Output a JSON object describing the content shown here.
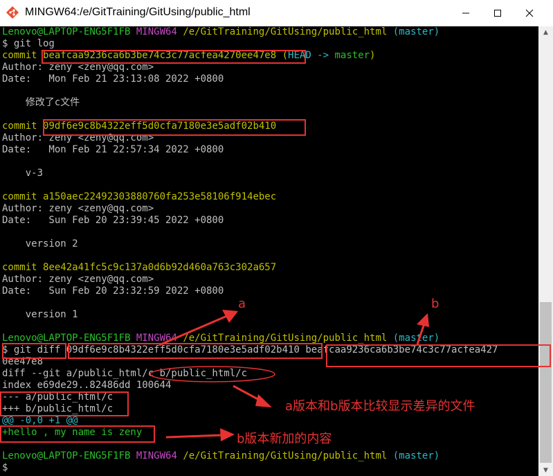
{
  "window": {
    "title": "MINGW64:/e/GitTraining/GitUsing/public_html",
    "icon": "git-bash-icon",
    "minimize_glyph": "—",
    "maximize_glyph": "☐",
    "close_glyph": "✕"
  },
  "colors": {
    "prompt_green": "#2bc02b",
    "prompt_magenta": "#c44ac4",
    "yellow": "#c0c000",
    "cyan": "#2fb8c6",
    "annotation_red": "#e83232"
  },
  "prompt": {
    "user_host": "Lenovo@LAPTOP-ENG5F1FB",
    "shell": "MINGW64",
    "path": "/e/GitTraining/GitUsing/public_html",
    "branch": "(master)"
  },
  "terminal": {
    "cmd_log": "$ git log",
    "commits": [
      {
        "commit_label": "commit ",
        "hash": "beafcaa9236ca6b3be74c3c77acfea4270ee47e8",
        "ref_open": " (",
        "ref_head": "HEAD -> ",
        "ref_master": "master",
        "ref_close": ")",
        "author": "Author: zeny <zeny@qq.com>",
        "date": "Date:   Mon Feb 21 23:13:08 2022 +0800",
        "message": "    修改了c文件"
      },
      {
        "commit_label": "commit ",
        "hash": "09df6e9c8b4322eff5d0cfa7180e3e5adf02b410",
        "author": "Author: zeny <zeny@qq.com>",
        "date": "Date:   Mon Feb 21 22:57:34 2022 +0800",
        "message": "    v-3"
      },
      {
        "commit_label": "commit ",
        "hash": "a150aec22492303880760fa253e58106f914ebec",
        "author": "Author: zeny <zeny@qq.com>",
        "date": "Date:   Sun Feb 20 23:39:45 2022 +0800",
        "message": "    version 2"
      },
      {
        "commit_label": "commit ",
        "hash": "8ee42a41fc5c9c137a0d6b92d460a763c302a657",
        "author": "Author: zeny <zeny@qq.com>",
        "date": "Date:   Sun Feb 20 23:32:59 2022 +0800",
        "message": "    version 1"
      }
    ],
    "cmd_diff": "$ git diff ",
    "diff_hash_a": "09df6e9c8b4322eff5d0cfa7180e3e5adf02b410",
    "diff_hash_b": "beafcaa9236ca6b3be74c3c77acfea427",
    "diff_hash_b_wrap": "0ee47e8",
    "diff_header": "diff --git a/public_html/c b/public_html/c",
    "diff_index": "index e69de29..82486dd 100644",
    "diff_minus": "--- a/public_html/c",
    "diff_plus": "+++ b/public_html/c",
    "diff_hunk": "@@ -0,0 +1 @@",
    "diff_added": "+hello , my name is zeny",
    "final_prompt": "$"
  },
  "annotations": {
    "label_a": "a",
    "label_b": "b",
    "note_files": "a版本和b版本比较显示差异的文件",
    "note_added": "b版本新加的内容"
  }
}
